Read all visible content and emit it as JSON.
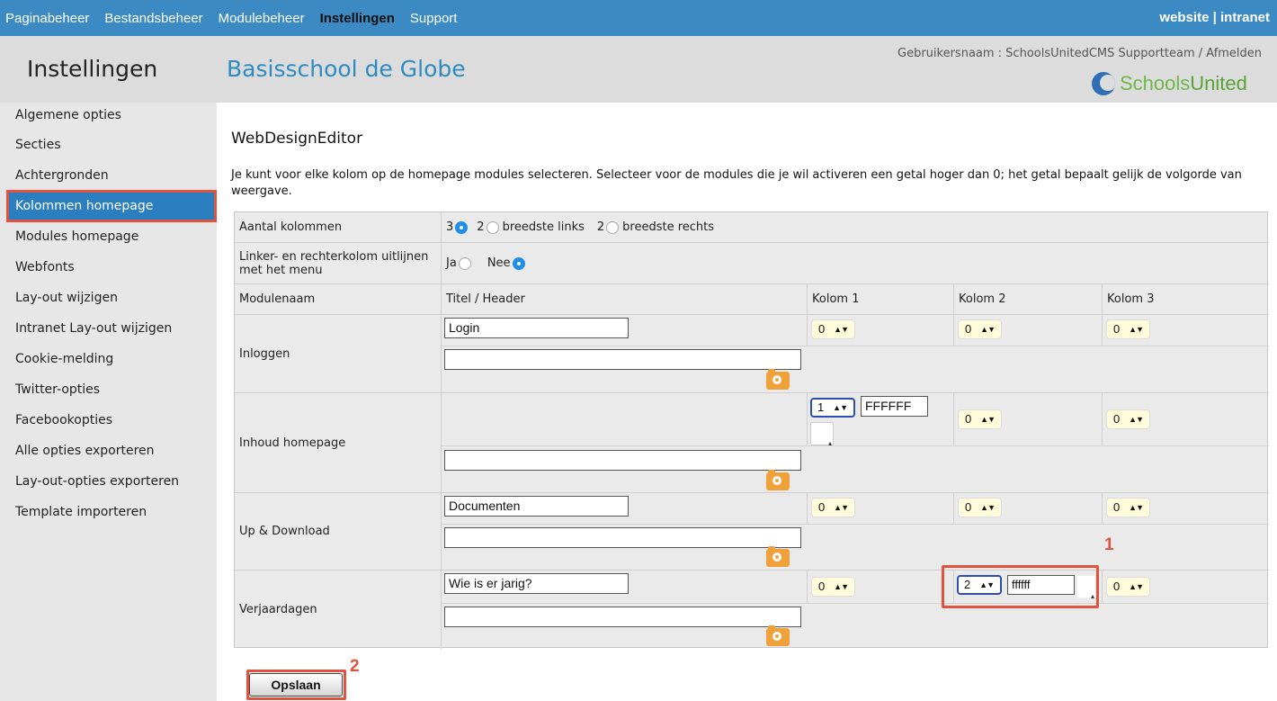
{
  "topnav": {
    "tabs": [
      "Paginabeheer",
      "Bestandsbeheer",
      "Modulebeheer",
      "Instellingen",
      "Support"
    ],
    "active_tab": "Instellingen",
    "right_website": "website",
    "right_sep": "|",
    "right_intranet": "intranet"
  },
  "header": {
    "section_title": "Instellingen",
    "school_name": "Basisschool de Globe",
    "user_info": "Gebruikersnaam : SchoolsUnitedCMS Supportteam / Afmelden",
    "logo_text_1": "Schools",
    "logo_text_2": "United"
  },
  "sidebar": {
    "items": [
      "Algemene opties",
      "Secties",
      "Achtergronden",
      "Kolommen homepage",
      "Modules homepage",
      "Webfonts",
      "Lay-out wijzigen",
      "Intranet Lay-out wijzigen",
      "Cookie-melding",
      "Twitter-opties",
      "Facebookopties",
      "Alle opties exporteren",
      "Lay-out-opties exporteren",
      "Template importeren"
    ],
    "active": "Kolommen homepage"
  },
  "main": {
    "title": "WebDesignEditor",
    "intro": "Je kunt voor elke kolom op de homepage modules selecteren. Selecteer voor de modules die je wil activeren een getal hoger dan 0; het getal bepaalt gelijk de volgorde van weergave."
  },
  "settings": {
    "aantal_label": "Aantal kolommen",
    "opt_3": "3",
    "opt_2a": "2",
    "opt_2a_text": "breedste links",
    "opt_2b": "2",
    "opt_2b_text": "breedste rechts",
    "selected_columns": "3",
    "align_label": "Linker- en rechterkolom uitlijnen met het menu",
    "align_ja": "Ja",
    "align_nee": "Nee",
    "align_selected": "Nee"
  },
  "table": {
    "headers": [
      "Modulenaam",
      "Titel / Header",
      "Kolom 1",
      "Kolom 2",
      "Kolom 3"
    ],
    "modules": [
      {
        "name": "Inloggen",
        "title": "Login",
        "k1": "0",
        "k2": "0",
        "k3": "0",
        "color_value": ""
      },
      {
        "name": "Inhoud homepage",
        "title": "",
        "k1": "1",
        "k2": "0",
        "k3": "0",
        "color_value": "FFFFFF"
      },
      {
        "name": "Up & Download",
        "title": "Documenten",
        "k1": "0",
        "k2": "0",
        "k3": "0",
        "color_value": ""
      },
      {
        "name": "Verjaardagen",
        "title": "Wie is er jarig?",
        "k1": "0",
        "k2": "2",
        "k3": "0",
        "color_value": "ffffff"
      }
    ]
  },
  "annotations": {
    "marker_1": "1",
    "marker_2": "2"
  },
  "save_label": "Opslaan",
  "colors": {
    "nav_bg": "#3b8ac3",
    "accent": "#2b7fc0",
    "highlight": "#e0533f",
    "camera": "#f1a13a"
  }
}
